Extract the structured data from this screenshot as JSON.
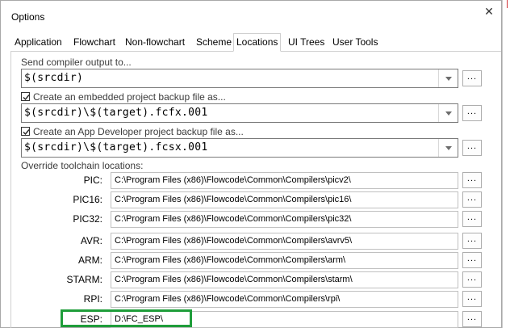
{
  "dialog": {
    "title": "Options",
    "close_glyph": "✕"
  },
  "tabs": [
    {
      "label": "Application",
      "active": false
    },
    {
      "label": "Flowchart",
      "active": false
    },
    {
      "label": "Non-flowchart",
      "active": false
    },
    {
      "label": "Scheme",
      "active": false
    },
    {
      "label": "Locations",
      "active": true
    },
    {
      "label": "UI Trees",
      "active": false
    },
    {
      "label": "User Tools",
      "active": false
    }
  ],
  "compiler_output": {
    "label": "Send compiler output to...",
    "value": "$(srcdir)",
    "browse_label": "..."
  },
  "embedded_backup": {
    "label": "Create an embedded project backup file as...",
    "checked": true,
    "value": "$(srcdir)\\$(target).fcfx.001",
    "browse_label": "..."
  },
  "app_dev_backup": {
    "label": "Create an App Developer project backup file as...",
    "checked": true,
    "value": "$(srcdir)\\$(target).fcsx.001",
    "browse_label": "..."
  },
  "toolchains": {
    "heading": "Override toolchain locations:",
    "items": [
      {
        "label": "PIC:",
        "path": "C:\\Program Files (x86)\\Flowcode\\Common\\Compilers\\picv2\\",
        "browse_label": "..."
      },
      {
        "label": "PIC16:",
        "path": "C:\\Program Files (x86)\\Flowcode\\Common\\Compilers\\pic16\\",
        "browse_label": "..."
      },
      {
        "label": "PIC32:",
        "path": "C:\\Program Files (x86)\\Flowcode\\Common\\Compilers\\pic32\\",
        "browse_label": "..."
      },
      {
        "label": "AVR:",
        "path": "C:\\Program Files (x86)\\Flowcode\\Common\\Compilers\\avrv5\\",
        "browse_label": "..."
      },
      {
        "label": "ARM:",
        "path": "C:\\Program Files (x86)\\Flowcode\\Common\\Compilers\\arm\\",
        "browse_label": "..."
      },
      {
        "label": "STARM:",
        "path": "C:\\Program Files (x86)\\Flowcode\\Common\\Compilers\\starm\\",
        "browse_label": "..."
      },
      {
        "label": "RPI:",
        "path": "C:\\Program Files (x86)\\Flowcode\\Common\\Compilers\\rpi\\",
        "browse_label": "..."
      },
      {
        "label": "ESP:",
        "path": "D:\\FC_ESP\\",
        "browse_label": "..."
      }
    ]
  },
  "colors": {
    "highlight": "#1f9d3a",
    "window_border": "#a8a8a8"
  }
}
